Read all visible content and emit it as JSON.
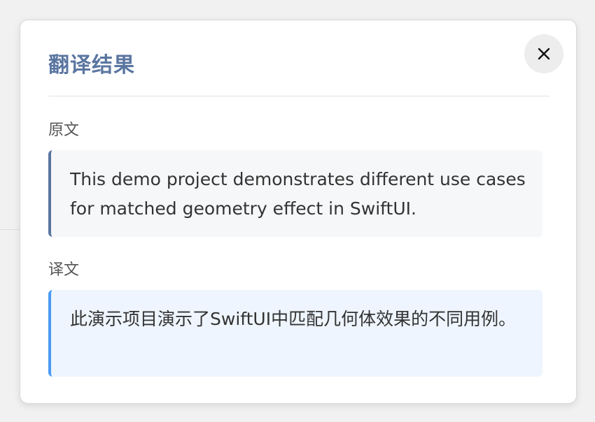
{
  "dialog": {
    "title": "翻译结果",
    "close_icon": "close-icon",
    "original": {
      "label": "原文",
      "text": "This demo project demonstrates different use cases for matched geometry effect in SwiftUI."
    },
    "translation": {
      "label": "译文",
      "text": "此演示项目演示了SwiftUI中匹配几何体效果的不同用例。"
    }
  },
  "colors": {
    "title": "#5a76a0",
    "original_accent": "#5a76a0",
    "translation_accent": "#4a9bf2",
    "original_bg": "#f6f7f9",
    "translation_bg": "#eef5fe"
  }
}
